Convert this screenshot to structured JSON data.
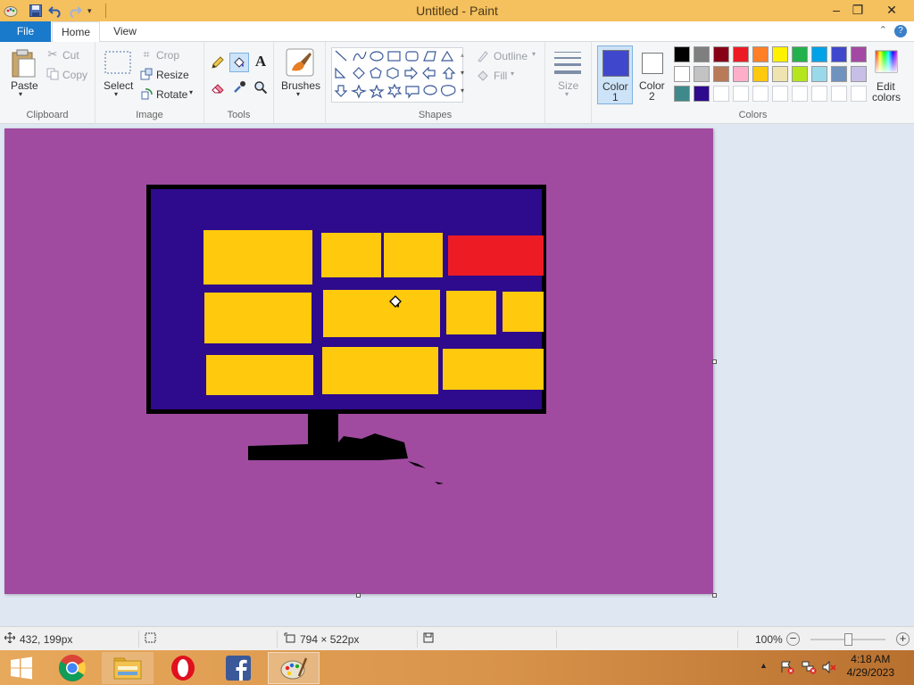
{
  "window": {
    "title": "Untitled - Paint",
    "minimize": "–",
    "restore": "❐",
    "close": "✕"
  },
  "ribbon_tabs": {
    "file": "File",
    "home": "Home",
    "view": "View"
  },
  "clipboard": {
    "paste": "Paste",
    "cut": "Cut",
    "copy": "Copy",
    "group": "Clipboard"
  },
  "image": {
    "select": "Select",
    "crop": "Crop",
    "resize": "Resize",
    "rotate": "Rotate",
    "group": "Image"
  },
  "tools": {
    "group": "Tools"
  },
  "brushes": {
    "label": "Brushes"
  },
  "shapes": {
    "outline": "Outline",
    "fill": "Fill",
    "group": "Shapes"
  },
  "size": {
    "label": "Size"
  },
  "colors": {
    "color1_line1": "Color",
    "color1_line2": "1",
    "color2_line1": "Color",
    "color2_line2": "2",
    "edit_line1": "Edit",
    "edit_line2": "colors",
    "group": "Colors",
    "color1_value": "#3f48cc",
    "color2_value": "#ffffff",
    "palette": [
      "#000000",
      "#7f7f7f",
      "#880015",
      "#ed1c24",
      "#ff7f27",
      "#fff200",
      "#22b14c",
      "#00a2e8",
      "#3f48cc",
      "#a349a4",
      "#ffffff",
      "#c3c3c3",
      "#b97a57",
      "#ffaec9",
      "#ffc90e",
      "#efe4b0",
      "#b5e61d",
      "#99d9ea",
      "#7092be",
      "#c8bfe7",
      "#3e8a8a",
      "#2e0a8c",
      "#ffffff",
      "#ffffff",
      "#ffffff",
      "#ffffff",
      "#ffffff",
      "#ffffff",
      "#ffffff",
      "#ffffff"
    ]
  },
  "drawing": {
    "background": "#a04ba0",
    "screen_color": "#2e0a8c",
    "tile_color": "#ffc90e",
    "accent_tile_color": "#ed1c24",
    "frame_color": "#000000"
  },
  "status": {
    "cursor_pos": "432, 199px",
    "image_size": "794 × 522px",
    "zoom": "100%",
    "zoom_level": 1.0
  },
  "taskbar": {
    "time": "4:18 AM",
    "date": "4/29/2023"
  }
}
